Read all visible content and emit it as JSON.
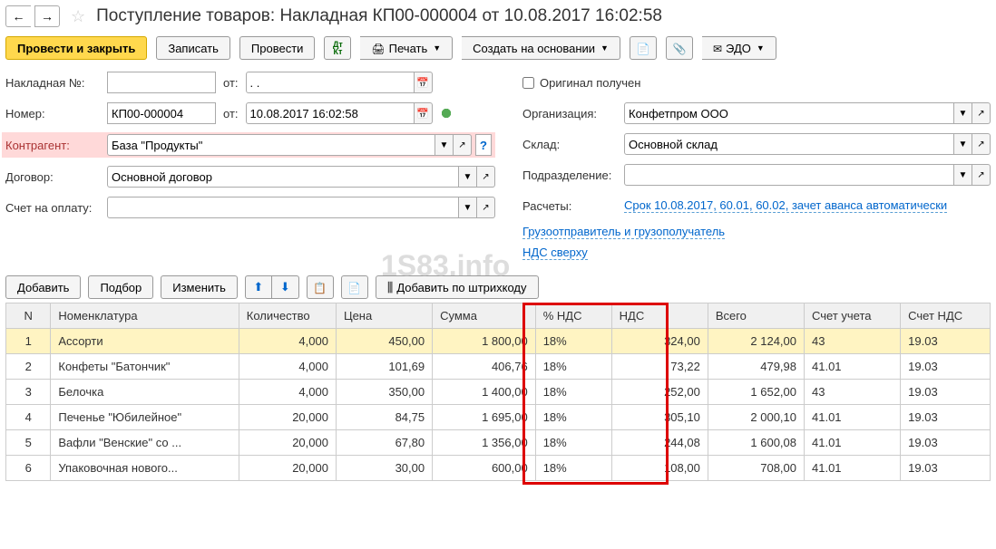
{
  "header": {
    "title": "Поступление товаров: Накладная КП00-000004 от 10.08.2017 16:02:58"
  },
  "toolbar": {
    "post_close": "Провести и закрыть",
    "save": "Записать",
    "post": "Провести",
    "print": "Печать",
    "create_based": "Создать на основании",
    "edo": "ЭДО"
  },
  "form": {
    "invoice_label": "Накладная №:",
    "invoice_value": "",
    "from_label": "от:",
    "invoice_date": ". .",
    "number_label": "Номер:",
    "number_value": "КП00-000004",
    "number_date": "10.08.2017 16:02:58",
    "counterparty_label": "Контрагент:",
    "counterparty_value": "База \"Продукты\"",
    "contract_label": "Договор:",
    "contract_value": "Основной договор",
    "payment_account_label": "Счет на оплату:",
    "payment_account_value": "",
    "original_received_label": "Оригинал получен",
    "organization_label": "Организация:",
    "organization_value": "Конфетпром ООО",
    "warehouse_label": "Склад:",
    "warehouse_value": "Основной склад",
    "subdivision_label": "Подразделение:",
    "subdivision_value": "",
    "settlements_label": "Расчеты:",
    "settlements_link": "Срок 10.08.2017, 60.01, 60.02, зачет аванса автоматически",
    "shipper_link": "Грузоотправитель и грузополучатель",
    "vat_link": "НДС сверху"
  },
  "watermark": "1S83.info",
  "table_toolbar": {
    "add": "Добавить",
    "select": "Подбор",
    "modify": "Изменить",
    "add_barcode": "Добавить по штрихкоду"
  },
  "table": {
    "headers": {
      "n": "N",
      "nomenclature": "Номенклатура",
      "quantity": "Количество",
      "price": "Цена",
      "sum": "Сумма",
      "vat_pct": "% НДС",
      "vat": "НДС",
      "total": "Всего",
      "account": "Счет учета",
      "vat_account": "Счет НДС"
    },
    "rows": [
      {
        "n": "1",
        "nom": "Ассорти",
        "qty": "4,000",
        "price": "450,00",
        "sum": "1 800,00",
        "vat_pct": "18%",
        "vat": "324,00",
        "total": "2 124,00",
        "acc": "43",
        "vat_acc": "19.03"
      },
      {
        "n": "2",
        "nom": "Конфеты \"Батончик\"",
        "qty": "4,000",
        "price": "101,69",
        "sum": "406,76",
        "vat_pct": "18%",
        "vat": "73,22",
        "total": "479,98",
        "acc": "41.01",
        "vat_acc": "19.03"
      },
      {
        "n": "3",
        "nom": "Белочка",
        "qty": "4,000",
        "price": "350,00",
        "sum": "1 400,00",
        "vat_pct": "18%",
        "vat": "252,00",
        "total": "1 652,00",
        "acc": "43",
        "vat_acc": "19.03"
      },
      {
        "n": "4",
        "nom": "Печенье \"Юбилейное\"",
        "qty": "20,000",
        "price": "84,75",
        "sum": "1 695,00",
        "vat_pct": "18%",
        "vat": "305,10",
        "total": "2 000,10",
        "acc": "41.01",
        "vat_acc": "19.03"
      },
      {
        "n": "5",
        "nom": "Вафли \"Венские\" со ...",
        "qty": "20,000",
        "price": "67,80",
        "sum": "1 356,00",
        "vat_pct": "18%",
        "vat": "244,08",
        "total": "1 600,08",
        "acc": "41.01",
        "vat_acc": "19.03"
      },
      {
        "n": "6",
        "nom": "Упаковочная нового...",
        "qty": "20,000",
        "price": "30,00",
        "sum": "600,00",
        "vat_pct": "18%",
        "vat": "108,00",
        "total": "708,00",
        "acc": "41.01",
        "vat_acc": "19.03"
      }
    ]
  }
}
